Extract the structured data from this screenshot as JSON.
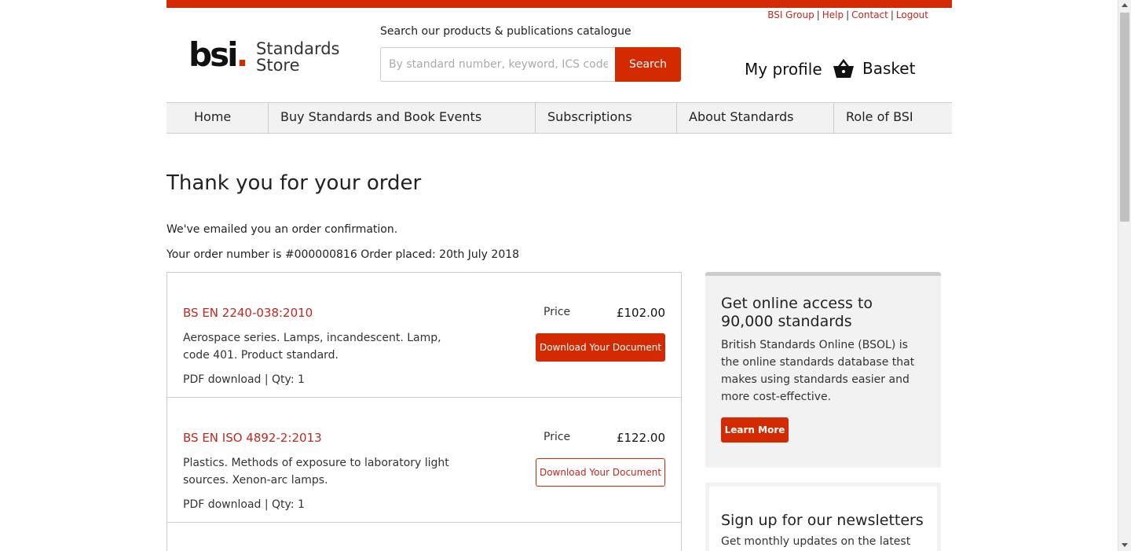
{
  "colors": {
    "brand": "#d42a02",
    "link": "#c0281e",
    "nav_bg": "#f2f2f2"
  },
  "header": {
    "util_links": [
      "BSI Group",
      "Help",
      "Contact",
      "Logout"
    ],
    "logo_mark": "bsi",
    "logo_dot": ".",
    "logo_store_line1": "Standards",
    "logo_store_line2": "Store",
    "search_label": "Search our products & publications catalogue",
    "search_placeholder": "By standard number, keyword, ICS code, ISBN",
    "search_button": "Search",
    "my_profile": "My profile",
    "basket": "Basket",
    "basket_icon": "basket-icon"
  },
  "nav": [
    "Home",
    "Buy Standards and Book Events",
    "Subscriptions",
    "About Standards",
    "Role of BSI"
  ],
  "main": {
    "heading": "Thank you for your order",
    "emailed": "We've emailed you an order confirmation.",
    "order_number_label": "Your order number is #000000816",
    "order_placed": "Order placed: 20th July 2018",
    "orders": [
      {
        "code": "BS EN 2240-038:2010",
        "description": "Aerospace series. Lamps, incandescent. Lamp, code 401. Product standard.",
        "meta": "PDF download | Qty: 1",
        "price_label": "Price",
        "price": "£102.00",
        "button": "Download Your Document"
      },
      {
        "code": "BS EN ISO 4892-2:2013",
        "description": "Plastics. Methods of exposure to laboratory light sources. Xenon-arc lamps.",
        "meta": "PDF download | Qty: 1",
        "price_label": "Price",
        "price": "£122.00",
        "button": "Download Your Document"
      }
    ]
  },
  "sidebar": {
    "promo_title": "Get online access to 90,000 standards",
    "promo_text": "British Standards Online (BSOL) is the online standards database that makes using standards easier and more cost-effective.",
    "promo_button": "Learn More",
    "news_title": "Sign up for our newsletters",
    "news_text": "Get monthly updates on the latest"
  }
}
